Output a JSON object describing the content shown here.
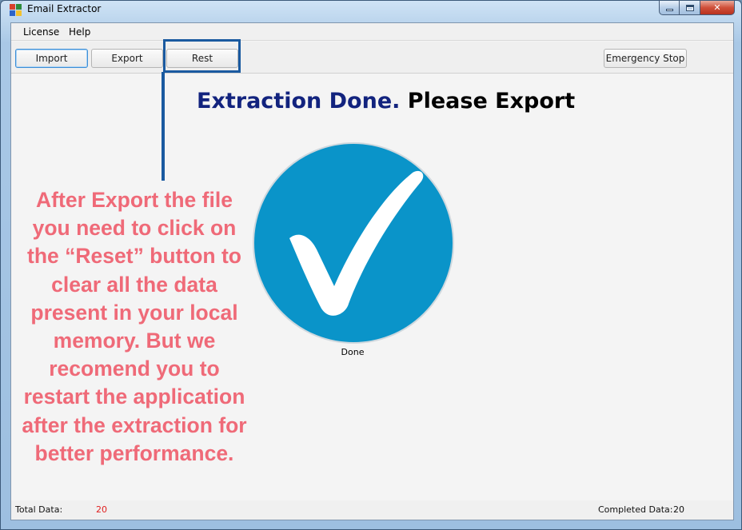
{
  "window": {
    "title": "Email Extractor",
    "controls": {
      "minimize": "",
      "maximize": "",
      "close": "✕"
    }
  },
  "menu": {
    "items": [
      "License",
      "Help"
    ]
  },
  "toolbar": {
    "import_label": "Import",
    "export_label": "Export",
    "reset_label": "Rest",
    "emergency_label": "Emergency Stop"
  },
  "main": {
    "heading_part1": "Extraction Done.",
    "heading_part2": "Please Export",
    "status_label": "Done",
    "circle_color": "#0a94c9"
  },
  "statusbar": {
    "total_label": "Total Data:",
    "total_value": "20",
    "total_value_color": "#e02020",
    "completed_label": "Completed Data:",
    "completed_value": "20"
  },
  "annotation": {
    "text": "After Export the file you need to click on the “Reset” button to clear all the data present in your local memory. But we recomend you to restart the application after the extraction for better performance.",
    "color": "#ef6a78",
    "highlight_color": "#1a5aa0"
  }
}
